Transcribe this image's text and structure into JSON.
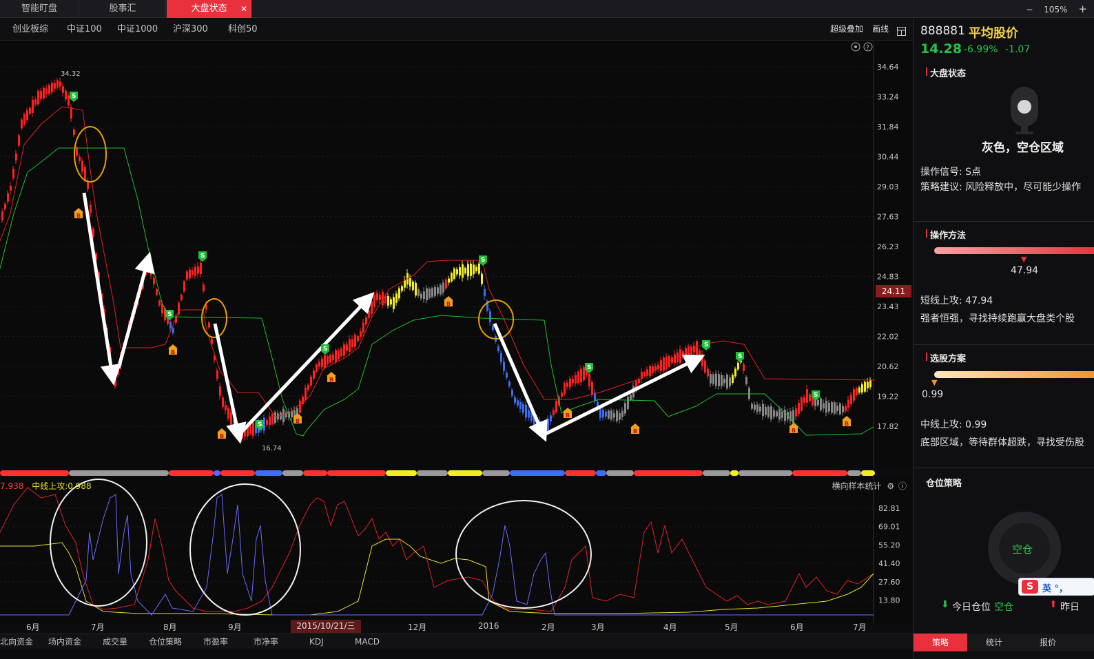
{
  "top_tabs": [
    {
      "label": "智能盯盘"
    },
    {
      "label": "股事汇"
    },
    {
      "label": "大盘状态"
    }
  ],
  "window": {
    "minimize": "−",
    "zoom": "105%",
    "add": "+"
  },
  "index_tabs": [
    {
      "label": "创业板综"
    },
    {
      "label": "中证100"
    },
    {
      "label": "中证1000"
    },
    {
      "label": "沪深300"
    },
    {
      "label": "科创50"
    }
  ],
  "toolbar": {
    "overlay": "超级叠加",
    "draw": "画线",
    "layout_icon": "grid-icon"
  },
  "main_chart": {
    "high_label": "34.32",
    "low_label": "16.74",
    "current_price": "24.11",
    "y_ticks": [
      "34.64",
      "33.24",
      "31.84",
      "30.44",
      "29.03",
      "27.63",
      "26.23",
      "24.83",
      "23.43",
      "22.02",
      "20.62",
      "19.22",
      "17.82"
    ]
  },
  "sub_chart": {
    "legend_short": "7.938",
    "legend_mid": "中线上攻:0.988",
    "right_label": "横向样本统计",
    "y_ticks": [
      "82.81",
      "69.01",
      "55.20",
      "41.40",
      "27.60",
      "13.80"
    ]
  },
  "months": [
    "6月",
    "7月",
    "8月",
    "9月",
    "12月",
    "2016",
    "2月",
    "3月",
    "4月",
    "5月",
    "6月",
    "7月"
  ],
  "date_chip": "2015/10/21/三",
  "bottom_tabs": [
    {
      "label": "北向资金"
    },
    {
      "label": "场内资金"
    },
    {
      "label": "成交量"
    },
    {
      "label": "仓位策略"
    },
    {
      "label": "市盈率"
    },
    {
      "label": "市净率"
    },
    {
      "label": "KDJ"
    },
    {
      "label": "MACD"
    }
  ],
  "right_panel": {
    "code": "888881",
    "name": "平均股价",
    "price": "14.28",
    "change_pct": "-6.99%",
    "change": "-1.07",
    "section_market": "大盘状态",
    "status": "灰色，空仓区域",
    "signal": "操作信号: S点",
    "advice": "策略建议: 风险释放中，尽可能少操作",
    "section_method": "操作方法",
    "short_marker": "47.94",
    "short_label": "短线上攻: 47.94",
    "short_desc": "强者恒强，寻找持续跑赢大盘类个股",
    "section_pick": "选股方案",
    "mid_marker": "0.99",
    "mid_label": "中线上攻: 0.99",
    "mid_desc": "底部区域，等待群体超跌，寻找受伤股",
    "section_position": "仓位策略",
    "position_circle": "空仓",
    "today_label": "今日仓位",
    "today_value": "空仓",
    "yesterday_label": "昨日",
    "ime_text": "英 °，",
    "tabs": [
      {
        "label": "策略"
      },
      {
        "label": "统计"
      },
      {
        "label": "报价"
      }
    ],
    "colors": {
      "accent": "#e8313d",
      "up": "#ff3535",
      "down": "#27c24c",
      "name": "#f3d04b"
    }
  }
}
